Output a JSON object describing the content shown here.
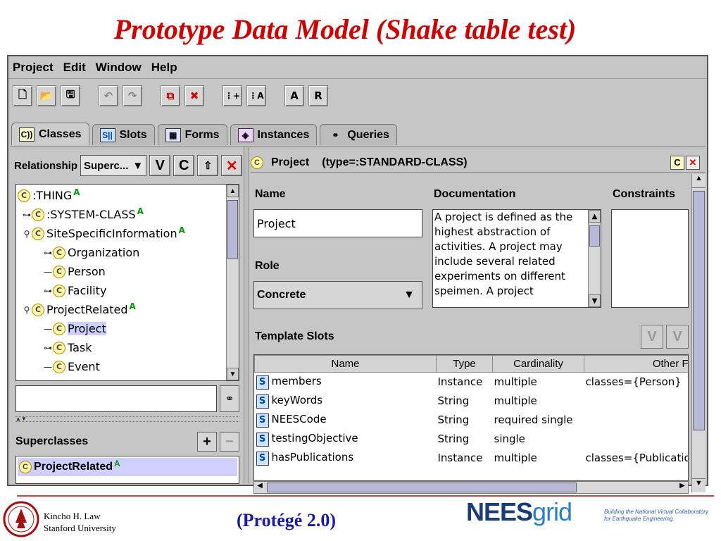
{
  "slide": {
    "title": "Prototype Data Model (Shake table test)",
    "footer_author": "Kincho H. Law",
    "footer_org": "Stanford University",
    "footer_center": "(Protégé 2.0)",
    "nees_logo_a": "NEES",
    "nees_logo_b": "grid",
    "nees_tagline_1": "Building the National Virtual Collaboratory",
    "nees_tagline_2": "for Earthquake Engineering."
  },
  "menu": [
    "Project",
    "Edit",
    "Window",
    "Help"
  ],
  "toolbar": {
    "a_label": "A",
    "r_label": "R"
  },
  "tabs": [
    {
      "label": "Classes",
      "icon": "C))"
    },
    {
      "label": "Slots",
      "icon": "S||"
    },
    {
      "label": "Forms",
      "icon": "▦"
    },
    {
      "label": "Instances",
      "icon": "◈"
    },
    {
      "label": "Queries",
      "icon": "🔍"
    }
  ],
  "left": {
    "relationship_label": "Relationship",
    "relationship_value": "Superc...",
    "btn_v": "V",
    "btn_c": "C",
    "tree": [
      {
        "label": ":THING",
        "badge": "A",
        "handle": ""
      },
      {
        "label": ":SYSTEM-CLASS",
        "badge": "A",
        "handle": "⊶"
      },
      {
        "label": "SiteSpecificInformation",
        "badge": "A",
        "handle": "⚲"
      },
      {
        "label": "Organization",
        "badge": "",
        "handle": "⊶"
      },
      {
        "label": "Person",
        "badge": "",
        "handle": "—"
      },
      {
        "label": "Facility",
        "badge": "",
        "handle": "⊶"
      },
      {
        "label": "ProjectRelated",
        "badge": "A",
        "handle": "⚲"
      },
      {
        "label": "Project",
        "badge": "",
        "handle": "—"
      },
      {
        "label": "Task",
        "badge": "",
        "handle": "⊶"
      },
      {
        "label": "Event",
        "badge": "",
        "handle": "—"
      }
    ],
    "superclasses_label": "Superclasses",
    "superclass_item": "ProjectRelated",
    "superclass_badge": "A"
  },
  "right": {
    "header_name": "Project",
    "header_type": "(type=:STANDARD-CLASS)",
    "name_label": "Name",
    "name_value": "Project",
    "doc_label": "Documentation",
    "doc_value": "A project is defined as the highest abstraction of activities. A project may include several related experiments on different speimen.  A project",
    "constraints_label": "Constraints",
    "role_label": "Role",
    "role_value": "Concrete",
    "template_slots_label": "Template Slots",
    "slot_columns": [
      "Name",
      "Type",
      "Cardinality",
      "Other Fa"
    ],
    "slots": [
      {
        "name": "members",
        "type": "Instance",
        "card": "multiple",
        "other": "classes={Person}"
      },
      {
        "name": "keyWords",
        "type": "String",
        "card": "multiple",
        "other": ""
      },
      {
        "name": "NEESCode",
        "type": "String",
        "card": "required single",
        "other": ""
      },
      {
        "name": "testingObjective",
        "type": "String",
        "card": "single",
        "other": ""
      },
      {
        "name": "hasPublications",
        "type": "Instance",
        "card": "multiple",
        "other": "classes={Publication"
      }
    ]
  }
}
